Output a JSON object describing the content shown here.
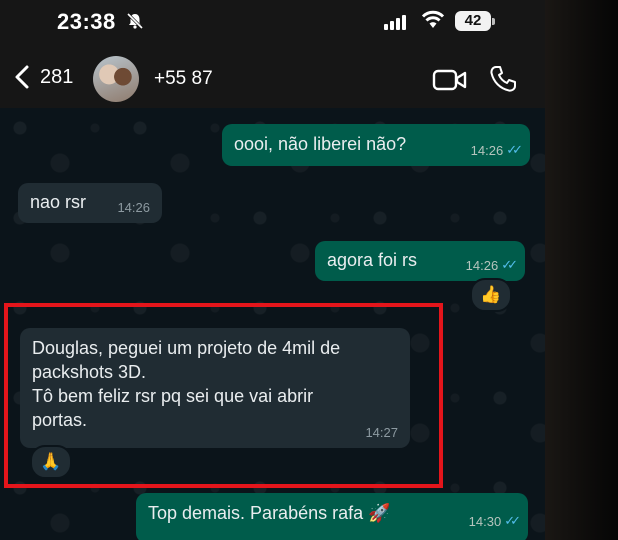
{
  "status_bar": {
    "time": "23:38",
    "battery": "42"
  },
  "header": {
    "back_count": "281",
    "contact_name": "+55 87"
  },
  "messages": [
    {
      "direction": "outgoing",
      "text": "oooi, não liberei não?",
      "time": "14:26"
    },
    {
      "direction": "incoming",
      "text": "nao rsr",
      "time": "14:26"
    },
    {
      "direction": "outgoing",
      "text": "agora foi rs",
      "time": "14:26",
      "reaction": "👍"
    },
    {
      "direction": "incoming",
      "lines": [
        "Douglas, peguei um projeto de 4mil de",
        "packshots 3D.",
        "Tô bem feliz rsr pq sei que vai abrir",
        "portas."
      ],
      "time": "14:27",
      "reaction": "🙏"
    },
    {
      "direction": "outgoing",
      "text": "Top demais. Parabéns rafa 🚀",
      "time": "14:30"
    }
  ],
  "read_ticks": "✓✓",
  "colors": {
    "outgoing_bubble": "#005c4b",
    "incoming_bubble": "#202c33",
    "highlight": "#e4151b",
    "read_ticks": "#53bdeb"
  }
}
